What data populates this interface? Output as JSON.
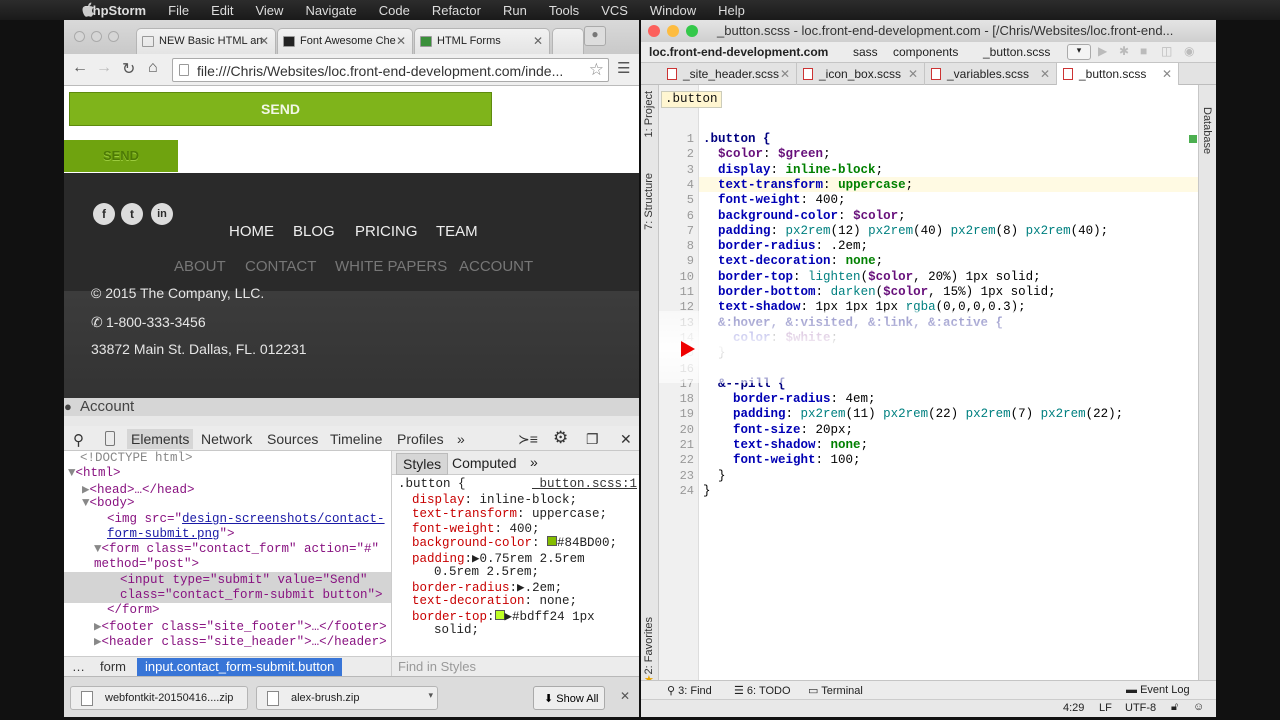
{
  "menubar": {
    "app": "PhpStorm",
    "items": [
      "File",
      "Edit",
      "View",
      "Navigate",
      "Code",
      "Refactor",
      "Run",
      "Tools",
      "VCS",
      "Window",
      "Help"
    ]
  },
  "chrome": {
    "tabs": [
      {
        "label": "NEW Basic HTML an"
      },
      {
        "label": "Font Awesome Che"
      },
      {
        "label": "HTML Forms"
      }
    ],
    "url": "file:///Chris/Websites/loc.front-end-development.com/inde...",
    "page": {
      "send_primary": "SEND",
      "send_pill": "SEND",
      "social": [
        "f",
        "t",
        "in"
      ],
      "nav_primary": [
        "HOME",
        "BLOG",
        "PRICING",
        "TEAM"
      ],
      "nav_secondary": [
        "ABOUT",
        "CONTACT",
        "WHITE PAPERS",
        "ACCOUNT"
      ],
      "copyright": "© 2015 The Company, LLC.",
      "phone": "1-800-333-3456",
      "address": "33872 Main St. Dallas, FL. 012231",
      "account": "Account"
    },
    "devtools": {
      "tabs": [
        "Elements",
        "Network",
        "Sources",
        "Timeline",
        "Profiles"
      ],
      "elements": {
        "doctype": "<!DOCTYPE html>",
        "html": "<html>",
        "head": "<head>…</head>",
        "body": "<body>",
        "img_pre": "<img src=\"",
        "img_src1": "design-screenshots/contact-",
        "img_src2": "form-submit.png",
        "img_post": "\">",
        "form_line1": "<form class=\"contact_form\" action=\"#\"",
        "form_line2": "method=\"post\">",
        "input_line1": "<input type=\"submit\" value=\"Send\"",
        "input_line2": "class=\"contact_form-submit button\">",
        "form_close": "</form>",
        "footer": "<footer class=\"site_footer\">…</footer>",
        "header": "<header class=\"site_header\">…</header>"
      },
      "styles_tabs": [
        "Styles",
        "Computed"
      ],
      "styles": {
        "selector": ".button {",
        "source": "_button.scss:1",
        "rules": [
          {
            "prop": "display",
            "val": "inline-block;"
          },
          {
            "prop": "text-transform",
            "val": "uppercase;"
          },
          {
            "prop": "font-weight",
            "val": "400;"
          },
          {
            "prop": "background-color",
            "val": "#84BD00;"
          },
          {
            "prop": "padding",
            "val": "▶0.75rem 2.5rem"
          },
          {
            "prop": "",
            "val": "0.5rem 2.5rem;"
          },
          {
            "prop": "border-radius",
            "val": "▶.2em;"
          },
          {
            "prop": "text-decoration",
            "val": "none;"
          },
          {
            "prop": "border-top",
            "val": "▶#bdff24 1px"
          },
          {
            "prop": "",
            "val": "solid;"
          }
        ]
      },
      "crumbs": [
        "…",
        "form",
        "input.contact_form-submit.button"
      ],
      "find_placeholder": "Find in Styles"
    },
    "downloads": [
      {
        "name": "webfontkit-20150416....zip"
      },
      {
        "name": "alex-brush.zip"
      }
    ],
    "show_all": "Show All"
  },
  "ide": {
    "title": "_button.scss - loc.front-end-development.com - [/Chris/Websites/loc.front-end...",
    "nav_path": [
      "loc.front-end-development.com",
      "sass",
      "components",
      "_button.scss"
    ],
    "file_tabs": [
      "_site_header.scss",
      "_icon_box.scss",
      "_variables.scss",
      "_button.scss"
    ],
    "left_tools": [
      "1: Project",
      "7: Structure",
      "2: Favorites"
    ],
    "right_tools": [
      "Database"
    ],
    "breadcrumb": ".button",
    "bottom_tools": [
      "3: Find",
      "6: TODO",
      "Terminal",
      "Event Log"
    ],
    "status": {
      "position": "4:29",
      "line_sep": "LF",
      "encoding": "UTF-8"
    },
    "code": [
      ".button {",
      "  $color: $green;",
      "  display: inline-block;",
      "  text-transform: uppercase;",
      "  font-weight: 400;",
      "  background-color: $color;",
      "  padding: px2rem(12) px2rem(40) px2rem(8) px2rem(40);",
      "  border-radius: .2em;",
      "  text-decoration: none;",
      "  border-top: lighten($color, 20%) 1px solid;",
      "  border-bottom: darken($color, 15%) 1px solid;",
      "  text-shadow: 1px 1px 1px rgba(0,0,0,0.3);",
      "  &:hover, &:visited, &:link, &:active {",
      "    color: $white;",
      "  }",
      "",
      "  &--pill {",
      "    border-radius: 4em;",
      "    padding: px2rem(11) px2rem(22) px2rem(7) px2rem(22);",
      "    font-size: 20px;",
      "    text-shadow: none;",
      "    font-weight: 100;",
      "  }",
      "}"
    ]
  },
  "colors": {
    "green": "#7fb41b",
    "footer": "#2a2a2a",
    "select": "#3875d7"
  }
}
